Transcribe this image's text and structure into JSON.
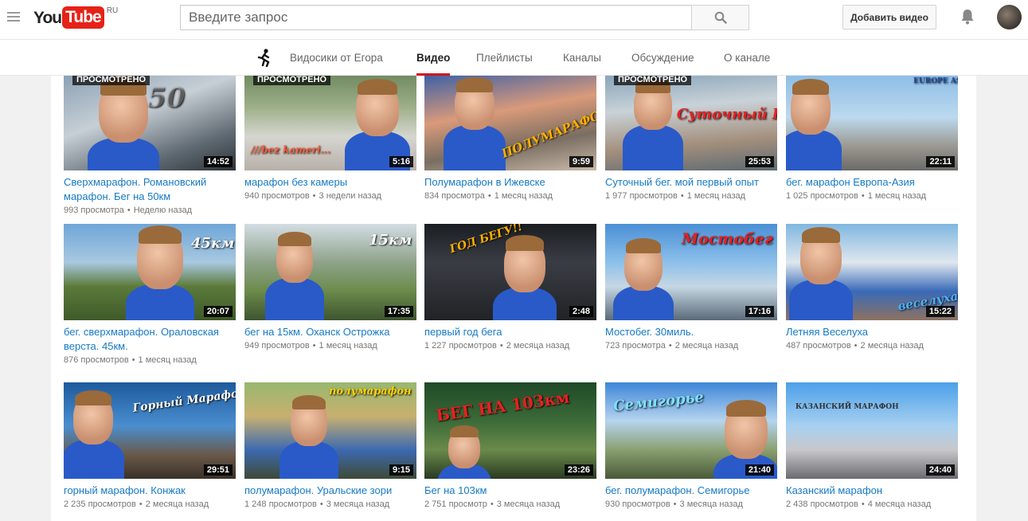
{
  "header": {
    "logo_you": "You",
    "logo_tube": "Tube",
    "logo_region": "RU",
    "search_placeholder": "Введите запрос",
    "upload_label": "Добавить видео"
  },
  "channel_nav": {
    "tabs": [
      {
        "label": "Видосики от Егора",
        "active": false
      },
      {
        "label": "Видео",
        "active": true
      },
      {
        "label": "Плейлисты",
        "active": false
      },
      {
        "label": "Каналы",
        "active": false
      },
      {
        "label": "Обсуждение",
        "active": false
      },
      {
        "label": "О канале",
        "active": false
      }
    ]
  },
  "videos": [
    {
      "title": "Сверхмарафон. Романовский марафон. Бег на 50км",
      "views": "993 просмотра",
      "age": "Неделю назад",
      "duration": "14:52",
      "watched": "ПРОСМОТРЕНО",
      "overlay": "50"
    },
    {
      "title": "марафон без камеры",
      "views": "940 просмотров",
      "age": "3 недели назад",
      "duration": "5:16",
      "watched": "ПРОСМОТРЕНО",
      "overlay": "///bez kameri..."
    },
    {
      "title": "Полумарафон в Ижевске",
      "views": "834 просмотра",
      "age": "1 месяц назад",
      "duration": "9:59",
      "watched": "",
      "overlay": "ПОЛУМАРАФОН В ИЖЕВСКЕ"
    },
    {
      "title": "Суточный бег. мой первый опыт",
      "views": "1 977 просмотров",
      "age": "1 месяц назад",
      "duration": "25:53",
      "watched": "ПРОСМОТРЕНО",
      "overlay": "Суточный Бег"
    },
    {
      "title": "бег. марафон Европа-Азия",
      "views": "1 025 просмотров",
      "age": "1 месяц назад",
      "duration": "22:11",
      "watched": "",
      "overlay": "EUROPE ASIA"
    },
    {
      "title": "бег. сверхмарафон. Ораловская верста. 45км.",
      "views": "876 просмотров",
      "age": "1 месяц назад",
      "duration": "20:07",
      "watched": "",
      "overlay": "45км"
    },
    {
      "title": "бег на 15км. Оханск Острожка",
      "views": "949 просмотров",
      "age": "1 месяц назад",
      "duration": "17:35",
      "watched": "",
      "overlay": "15км"
    },
    {
      "title": "первый год бега",
      "views": "1 227 просмотров",
      "age": "2 месяца назад",
      "duration": "2:48",
      "watched": "",
      "overlay": "ГОД БЕГУ!!"
    },
    {
      "title": "Мостобег. 30миль.",
      "views": "723 просмотра",
      "age": "2 месяца назад",
      "duration": "17:16",
      "watched": "",
      "overlay": "Мостобег"
    },
    {
      "title": "Летняя Веселуха",
      "views": "487 просмотров",
      "age": "2 месяца назад",
      "duration": "15:22",
      "watched": "",
      "overlay": "веселуха"
    },
    {
      "title": "горный марафон. Конжак",
      "views": "2 235 просмотров",
      "age": "2 месяца назад",
      "duration": "29:51",
      "watched": "",
      "overlay": "Горный Марафон!!"
    },
    {
      "title": "полумарафон. Уральские зори",
      "views": "1 248 просмотров",
      "age": "3 месяца назад",
      "duration": "9:15",
      "watched": "",
      "overlay": "полумарафон"
    },
    {
      "title": "Бег на 103км",
      "views": "2 751 просмотр",
      "age": "3 месяца назад",
      "duration": "23:26",
      "watched": "",
      "overlay": "БЕГ НА 103км"
    },
    {
      "title": "бег. полумарафон. Семигорье",
      "views": "930 просмотров",
      "age": "3 месяца назад",
      "duration": "21:40",
      "watched": "",
      "overlay": "Семигорье"
    },
    {
      "title": "Казанский марафон",
      "views": "2 438 просмотров",
      "age": "4 месяца назад",
      "duration": "24:40",
      "watched": "",
      "overlay": "КАЗАНСКИЙ МАРАФОН"
    }
  ],
  "colors": {
    "accent": "#cc181e",
    "link": "#167ac6",
    "meta": "#767676"
  }
}
